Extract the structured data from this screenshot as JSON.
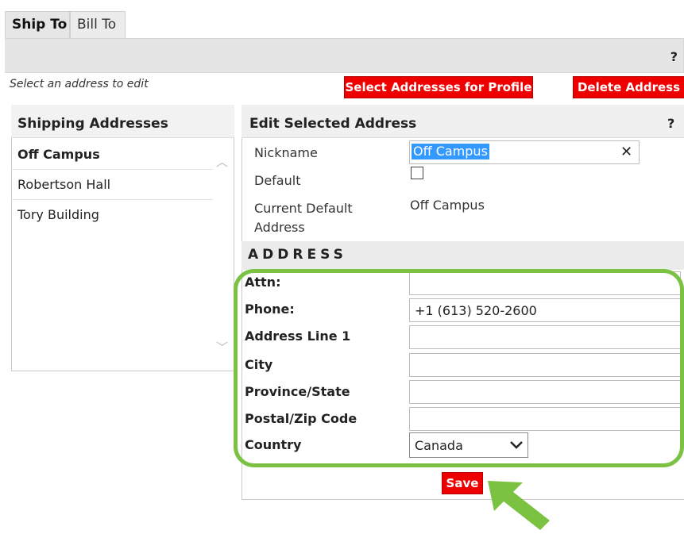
{
  "tabs": [
    {
      "label": "Ship To",
      "active": true
    },
    {
      "label": "Bill To",
      "active": false
    }
  ],
  "toolbar": {
    "help": "?",
    "hint": "Select an address to edit",
    "select_addresses_button": "Select Addresses for Profile",
    "delete_address_button": "Delete Address"
  },
  "shipping": {
    "title": "Shipping Addresses",
    "items": [
      {
        "label": "Off Campus",
        "selected": true
      },
      {
        "label": "Robertson Hall",
        "selected": false
      },
      {
        "label": "Tory Building",
        "selected": false
      }
    ]
  },
  "edit": {
    "title": "Edit Selected Address",
    "help": "?",
    "nickname_label": "Nickname",
    "nickname_value": "Off Campus",
    "default_label": "Default",
    "default_checked": false,
    "current_default_label_line1": "Current Default",
    "current_default_label_line2": "Address",
    "current_default_value": "Off Campus",
    "address_heading": "ADDRESS",
    "fields": {
      "attn_label": "Attn:",
      "attn_value": "",
      "phone_label": "Phone:",
      "phone_value": "+1 (613) 520-2600",
      "address1_label": "Address Line 1",
      "address1_value": "",
      "city_label": "City",
      "city_value": "",
      "province_label": "Province/State",
      "province_value": "",
      "postal_label": "Postal/Zip Code",
      "postal_value": "",
      "country_label": "Country",
      "country_value": "Canada"
    },
    "save_button": "Save"
  },
  "colors": {
    "accent_red": "#ee0000",
    "highlight_green": "#7cc242",
    "selection_blue": "#3399ff"
  }
}
